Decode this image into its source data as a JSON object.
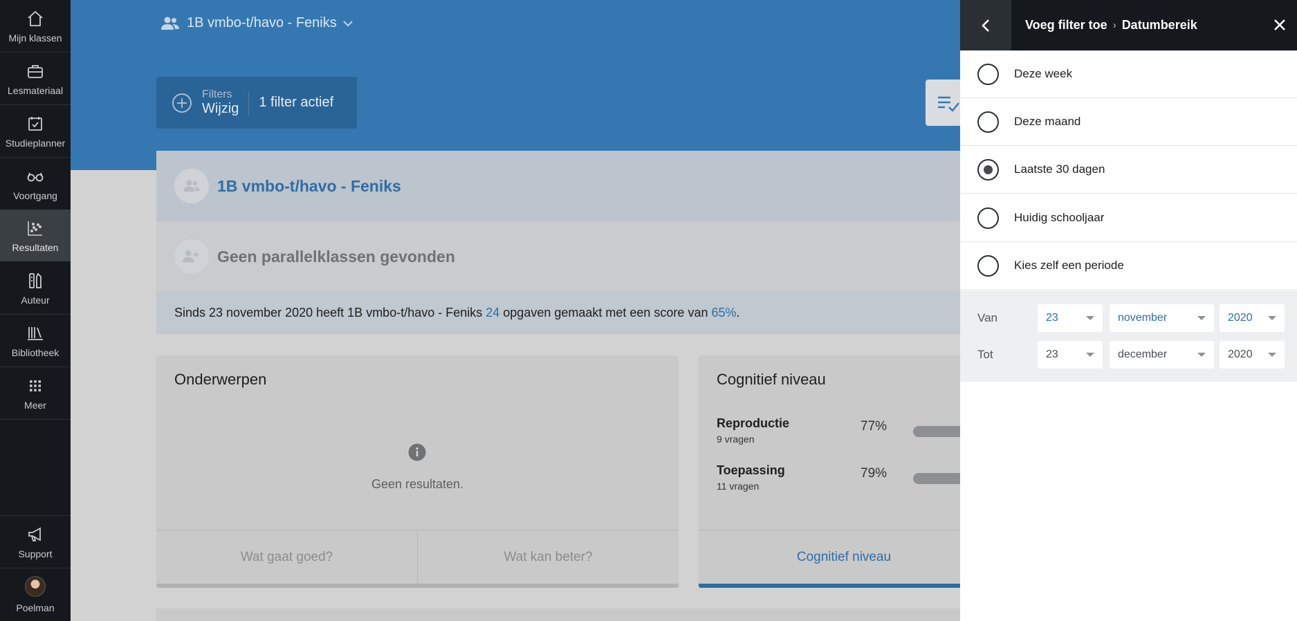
{
  "sidebar": {
    "items": [
      {
        "label": "Mijn klassen",
        "icon": "home-icon"
      },
      {
        "label": "Lesmateriaal",
        "icon": "briefcase-icon"
      },
      {
        "label": "Studieplanner",
        "icon": "calendar-check-icon"
      },
      {
        "label": "Voortgang",
        "icon": "glasses-icon"
      },
      {
        "label": "Resultaten",
        "icon": "scatter-chart-icon"
      },
      {
        "label": "Auteur",
        "icon": "author-tools-icon"
      },
      {
        "label": "Bibliotheek",
        "icon": "books-icon"
      },
      {
        "label": "Meer",
        "icon": "grid-icon"
      }
    ],
    "support": "Support",
    "user": "Poelman"
  },
  "header": {
    "class_selector": "1B vmbo-t/havo - Feniks"
  },
  "filters": {
    "label": "Filters",
    "edit": "Wijzig",
    "active": "1 filter actief"
  },
  "class_card": {
    "name": "1B vmbo-t/havo - Feniks",
    "parallel": "Geen parallelklassen gevonden",
    "summary_prefix": "Sinds 23 november 2020 heeft 1B vmbo-t/havo - Feniks",
    "summary_count": "24",
    "summary_middle": "opgaven gemaakt met een score van",
    "summary_score": "65%",
    "summary_suffix": "."
  },
  "topics": {
    "title": "Onderwerpen",
    "empty": "Geen resultaten.",
    "good": "Wat gaat goed?",
    "better": "Wat kan beter?"
  },
  "cognitive": {
    "title": "Cognitief niveau",
    "rows": [
      {
        "name": "Reproductie",
        "sub": "9 vragen",
        "pct": "77%"
      },
      {
        "name": "Toepassing",
        "sub": "11 vragen",
        "pct": "79%"
      }
    ],
    "footer": "Cognitief niveau"
  },
  "panel": {
    "crumb_parent": "Voeg filter toe",
    "crumb_sep": "›",
    "crumb_current": "Datumbereik",
    "options": [
      {
        "label": "Deze week",
        "checked": false
      },
      {
        "label": "Deze maand",
        "checked": false
      },
      {
        "label": "Laatste 30 dagen",
        "checked": true
      },
      {
        "label": "Huidig schooljaar",
        "checked": false
      },
      {
        "label": "Kies zelf een periode",
        "checked": false
      }
    ],
    "from": {
      "label": "Van",
      "day": "23",
      "month": "november",
      "year": "2020"
    },
    "to": {
      "label": "Tot",
      "day": "23",
      "month": "december",
      "year": "2020"
    }
  },
  "colors": {
    "topbar": "#3578b1",
    "accent": "#2f6da4",
    "sidebar": "#15191d"
  }
}
